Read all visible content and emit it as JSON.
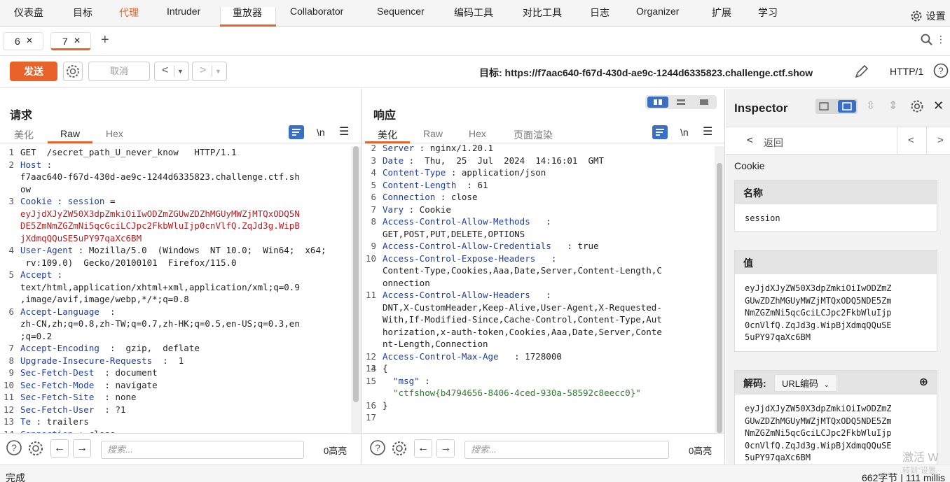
{
  "menu": {
    "tabs": [
      "仪表盘",
      "目标",
      "代理",
      "Intruder",
      "重放器",
      "Collaborator",
      "Sequencer",
      "编码工具",
      "对比工具",
      "日志",
      "Organizer",
      "扩展",
      "学习"
    ],
    "settings": "设置"
  },
  "req_tabs": [
    "6",
    "7"
  ],
  "toolbar": {
    "send": "发送",
    "cancel": "取消",
    "target": "目标: https://f7aac640-f67d-430d-ae9c-1244d6335823.challenge.ctf.show",
    "http_version": "HTTP/1"
  },
  "request": {
    "title": "请求",
    "tabs": [
      "美化",
      "Raw",
      "Hex"
    ],
    "newline_toggle": "\\n",
    "lines": [
      {
        "n": "1",
        "parts": [
          {
            "t": "GET  /secret_path_U_never_know   HTTP/1.1",
            "c": "hv"
          }
        ]
      },
      {
        "n": "2",
        "parts": [
          {
            "t": "Host",
            "c": "hk"
          },
          {
            "t": " : ",
            "c": "hv"
          }
        ]
      },
      {
        "n": "",
        "parts": [
          {
            "t": "f7aac640-f67d-430d-ae9c-1244d6335823.challenge.ctf.sh",
            "c": "hv"
          }
        ]
      },
      {
        "n": "",
        "parts": [
          {
            "t": "ow",
            "c": "hv"
          }
        ]
      },
      {
        "n": "3",
        "parts": [
          {
            "t": "Cookie",
            "c": "hk"
          },
          {
            "t": " : ",
            "c": "hv"
          },
          {
            "t": "session",
            "c": "hk"
          },
          {
            "t": " =",
            "c": "hv"
          }
        ]
      },
      {
        "n": "",
        "parts": [
          {
            "t": "eyJjdXJyZW50X3dpZmkiOiIwODZmZGUwZDZhMGUyMWZjMTQxODQ5N",
            "c": "hvred"
          }
        ]
      },
      {
        "n": "",
        "parts": [
          {
            "t": "DE5ZmNmZGZmNi5qcGciLCJpc2FkbWluIjp0cnVlfQ.ZqJd3g.WipB",
            "c": "hvred"
          }
        ]
      },
      {
        "n": "",
        "parts": [
          {
            "t": "jXdmqQQuSE5uPY97qaXc6BM",
            "c": "hvred"
          }
        ]
      },
      {
        "n": "4",
        "parts": [
          {
            "t": "User-Agent",
            "c": "hk"
          },
          {
            "t": " : Mozilla/5.0  (Windows  NT 10.0;  Win64;  x64;",
            "c": "hv"
          }
        ]
      },
      {
        "n": "",
        "parts": [
          {
            "t": " rv:109.0)  Gecko/20100101  Firefox/115.0",
            "c": "hv"
          }
        ]
      },
      {
        "n": "5",
        "parts": [
          {
            "t": "Accept",
            "c": "hk"
          },
          {
            "t": " :",
            "c": "hv"
          }
        ]
      },
      {
        "n": "",
        "parts": [
          {
            "t": "text/html,application/xhtml+xml,application/xml;q=0.9",
            "c": "hv"
          }
        ]
      },
      {
        "n": "",
        "parts": [
          {
            "t": ",image/avif,image/webp,*/*;q=0.8",
            "c": "hv"
          }
        ]
      },
      {
        "n": "6",
        "parts": [
          {
            "t": "Accept-Language",
            "c": "hk"
          },
          {
            "t": "  :",
            "c": "hv"
          }
        ]
      },
      {
        "n": "",
        "parts": [
          {
            "t": "zh-CN,zh;q=0.8,zh-TW;q=0.7,zh-HK;q=0.5,en-US;q=0.3,en",
            "c": "hv"
          }
        ]
      },
      {
        "n": "",
        "parts": [
          {
            "t": ";q=0.2",
            "c": "hv"
          }
        ]
      },
      {
        "n": "7",
        "parts": [
          {
            "t": "Accept-Encoding",
            "c": "hk"
          },
          {
            "t": "  :  gzip,  deflate",
            "c": "hv"
          }
        ]
      },
      {
        "n": "8",
        "parts": [
          {
            "t": "Upgrade-Insecure-Requests",
            "c": "hk"
          },
          {
            "t": "  :  1",
            "c": "hv"
          }
        ]
      },
      {
        "n": "9",
        "parts": [
          {
            "t": "Sec-Fetch-Dest",
            "c": "hk"
          },
          {
            "t": "  : document",
            "c": "hv"
          }
        ]
      },
      {
        "n": "10",
        "parts": [
          {
            "t": "Sec-Fetch-Mode",
            "c": "hk"
          },
          {
            "t": "  : navigate",
            "c": "hv"
          }
        ]
      },
      {
        "n": "11",
        "parts": [
          {
            "t": "Sec-Fetch-Site",
            "c": "hk"
          },
          {
            "t": "  : none",
            "c": "hv"
          }
        ]
      },
      {
        "n": "12",
        "parts": [
          {
            "t": "Sec-Fetch-User",
            "c": "hk"
          },
          {
            "t": "  : ?1",
            "c": "hv"
          }
        ]
      },
      {
        "n": "13",
        "parts": [
          {
            "t": "Te",
            "c": "hk"
          },
          {
            "t": " : trailers",
            "c": "hv"
          }
        ]
      },
      {
        "n": "14",
        "parts": [
          {
            "t": "Connection",
            "c": "hk"
          },
          {
            "t": " : close",
            "c": "hv"
          }
        ]
      }
    ],
    "search_placeholder": "搜索...",
    "highlights": "0高亮"
  },
  "response": {
    "title": "响应",
    "tabs": [
      "美化",
      "Raw",
      "Hex",
      "页面渲染"
    ],
    "newline_toggle": "\\n",
    "lines": [
      {
        "n": "2",
        "parts": [
          {
            "t": "Server",
            "c": "hk"
          },
          {
            "t": " : nginx/1.20.1",
            "c": "hv"
          }
        ]
      },
      {
        "n": "3",
        "parts": [
          {
            "t": "Date",
            "c": "hk"
          },
          {
            "t": " :  Thu,  25  Jul  2024  14:16:01  GMT",
            "c": "hv"
          }
        ]
      },
      {
        "n": "4",
        "parts": [
          {
            "t": "Content-Type",
            "c": "hk"
          },
          {
            "t": " : application/json",
            "c": "hv"
          }
        ]
      },
      {
        "n": "5",
        "parts": [
          {
            "t": "Content-Length",
            "c": "hk"
          },
          {
            "t": "  : 61",
            "c": "hv"
          }
        ]
      },
      {
        "n": "6",
        "parts": [
          {
            "t": "Connection",
            "c": "hk"
          },
          {
            "t": " : close",
            "c": "hv"
          }
        ]
      },
      {
        "n": "7",
        "parts": [
          {
            "t": "Vary",
            "c": "hk"
          },
          {
            "t": " : Cookie",
            "c": "hv"
          }
        ]
      },
      {
        "n": "8",
        "parts": [
          {
            "t": "Access-Control-Allow-Methods",
            "c": "hk"
          },
          {
            "t": "   :",
            "c": "hv"
          }
        ]
      },
      {
        "n": "",
        "parts": [
          {
            "t": "GET,POST,PUT,DELETE,OPTIONS",
            "c": "hv"
          }
        ]
      },
      {
        "n": "9",
        "parts": [
          {
            "t": "Access-Control-Allow-Credentials",
            "c": "hk"
          },
          {
            "t": "   : true",
            "c": "hv"
          }
        ]
      },
      {
        "n": "10",
        "parts": [
          {
            "t": "Access-Control-Expose-Headers",
            "c": "hk"
          },
          {
            "t": "   :",
            "c": "hv"
          }
        ]
      },
      {
        "n": "",
        "parts": [
          {
            "t": "Content-Type,Cookies,Aaa,Date,Server,Content-Length,C",
            "c": "hv"
          }
        ]
      },
      {
        "n": "",
        "parts": [
          {
            "t": "onnection",
            "c": "hv"
          }
        ]
      },
      {
        "n": "11",
        "parts": [
          {
            "t": "Access-Control-Allow-Headers",
            "c": "hk"
          },
          {
            "t": "   :",
            "c": "hv"
          }
        ]
      },
      {
        "n": "",
        "parts": [
          {
            "t": "DNT,X-CustomHeader,Keep-Alive,User-Agent,X-Requested-",
            "c": "hv"
          }
        ]
      },
      {
        "n": "",
        "parts": [
          {
            "t": "With,If-Modified-Since,Cache-Control,Content-Type,Aut",
            "c": "hv"
          }
        ]
      },
      {
        "n": "",
        "parts": [
          {
            "t": "horization,x-auth-token,Cookies,Aaa,Date,Server,Conte",
            "c": "hv"
          }
        ]
      },
      {
        "n": "",
        "parts": [
          {
            "t": "nt-Length,Connection",
            "c": "hv"
          }
        ]
      },
      {
        "n": "12",
        "parts": [
          {
            "t": "Access-Control-Max-Age",
            "c": "hk"
          },
          {
            "t": "   : 1728000",
            "c": "hv"
          }
        ]
      },
      {
        "n": "13",
        "parts": [
          {
            "t": "",
            "c": "hv"
          }
        ]
      },
      {
        "n": "14",
        "parts": [
          {
            "t": "{",
            "c": "hv"
          }
        ]
      },
      {
        "n": "15",
        "parts": [
          {
            "t": "  \"msg\"",
            "c": "jkey"
          },
          {
            "t": " :",
            "c": "hv"
          }
        ]
      },
      {
        "n": "",
        "parts": [
          {
            "t": "  \"ctfshow{b4794656-8406-4ced-930a-58592c8eecc0}\"",
            "c": "jstr"
          }
        ]
      },
      {
        "n": "16",
        "parts": [
          {
            "t": "}",
            "c": "hv"
          }
        ]
      },
      {
        "n": "17",
        "parts": [
          {
            "t": "",
            "c": "hv"
          }
        ]
      }
    ],
    "search_placeholder": "搜索...",
    "highlights": "0高亮"
  },
  "inspector": {
    "title": "Inspector",
    "back": "返回",
    "section": "Cookie",
    "name_label": "名称",
    "name_value": "session",
    "value_label": "值",
    "value_lines": [
      "eyJjdXJyZW50X3dpZmkiOiIwODZmZ",
      "GUwZDZhMGUyMWZjMTQxODQ5NDE5Zm",
      "NmZGZmNi5qcGciLCJpc2FkbWluIjp",
      "0cnVlfQ.ZqJd3g.WipBjXdmqQQuSE",
      "5uPY97qaXc6BM"
    ],
    "decode_label": "解码:",
    "decode_type": "URL编码",
    "decoded_lines": [
      "eyJjdXJyZW50X3dpZmkiOiIwODZmZ",
      "GUwZDZhMGUyMWZjMTQxODQ5NDE5Zm",
      "NmZGZmNi5qcGciLCJpc2FkbWluIjp",
      "0cnVlfQ.ZqJd3g.WipBjXdmqQQuSE",
      "5uPY97qaXc6BM"
    ]
  },
  "status": {
    "left": "完成",
    "right": "662字节 | 111 millis",
    "watermark": "激活 W",
    "watermark2": "转到\"设置"
  },
  "colors": {
    "accent": "#e8632a",
    "header_key": "#1c3ea6",
    "cookie_value": "#b22222",
    "json_string": "#2b7d2b",
    "toggle_active": "#3a6fc4"
  }
}
